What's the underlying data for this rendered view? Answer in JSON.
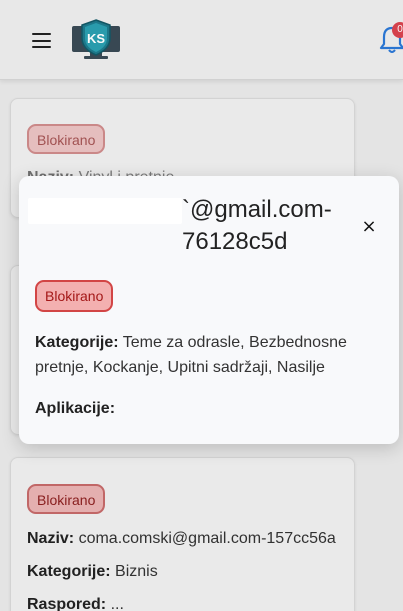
{
  "header": {
    "logo_text": "KS",
    "notification_count": "0"
  },
  "cards": [
    {
      "status": "Blokirano",
      "name_label": "Naziv:",
      "name_value": "Vinyl i pretnje"
    },
    {
      "status": "Blokirano",
      "name_label": "Naziv:",
      "name_value": "coma.comski@gmail.com-157cc56a",
      "category_label": "Kategorije:",
      "category_value": "Biznis",
      "schedule_label": "Raspored:",
      "schedule_value": "..."
    }
  ],
  "modal": {
    "title_visible": "`@gmail.com-76128c5d",
    "close_symbol": "×",
    "status": "Blokirano",
    "categories_label": "Kategorije:",
    "categories_value": "Teme za odrasle, Bezbednosne pretnje, Kockanje, Upitni sadržaji, Nasilje",
    "apps_label": "Aplikacije:"
  },
  "colors": {
    "blocked_bg": "#f3b0b0",
    "blocked_border": "#d24545",
    "blocked_text": "#a41818",
    "bell": "#2b78d6",
    "badge_red": "#d9434e"
  }
}
